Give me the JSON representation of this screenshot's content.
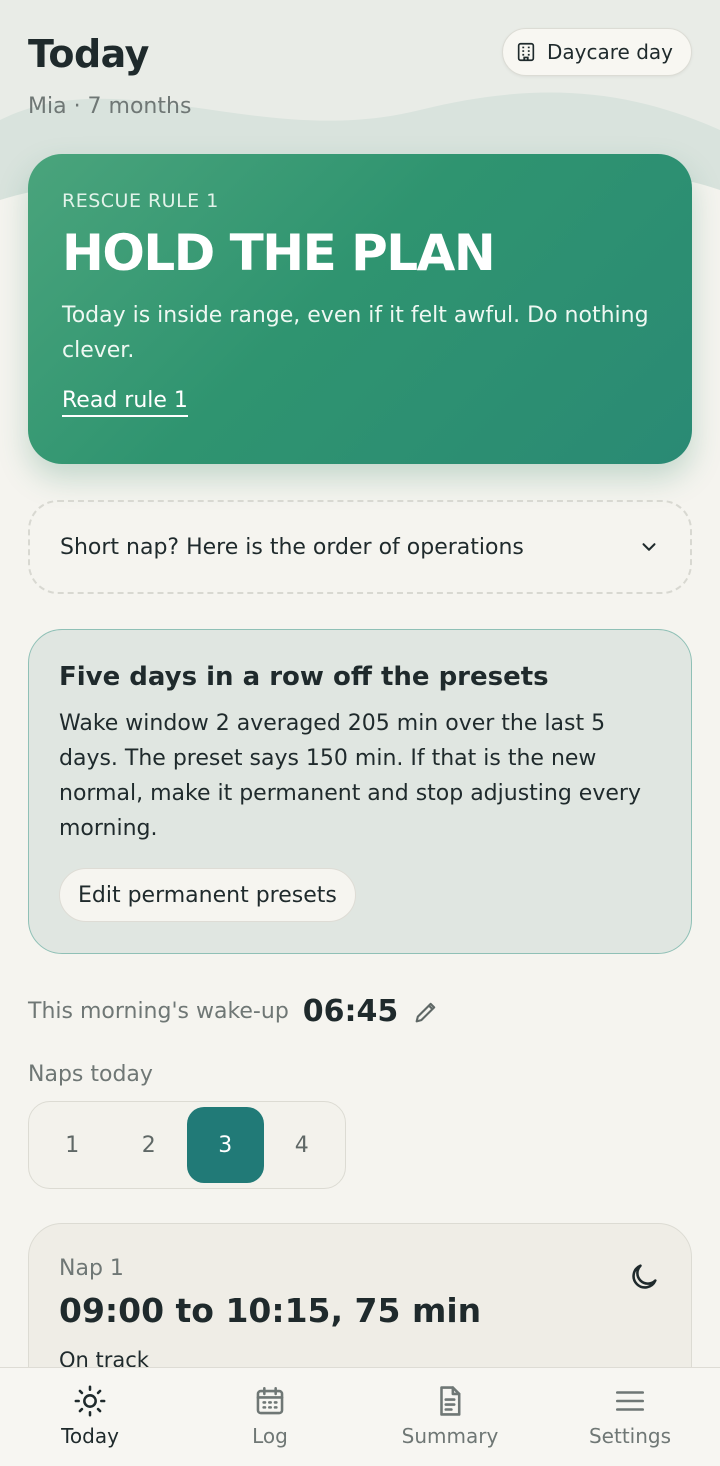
{
  "header": {
    "title": "Today",
    "subtitle": "Mia · 7 months",
    "daycare_button": {
      "label": "Daycare day",
      "icon": "building-icon"
    }
  },
  "rescue_card": {
    "kicker": "RESCUE RULE 1",
    "headline": "HOLD THE PLAN",
    "body": "Today is inside range, even if it felt awful. Do nothing clever.",
    "link": "Read rule 1",
    "colors": {
      "start": "#4aa47c",
      "end": "#2a8a74"
    }
  },
  "accordion": {
    "label": "Short nap? Here is the order of operations",
    "icon": "chevron-down-icon"
  },
  "preset_notice": {
    "title": "Five days in a row off the presets",
    "body": "Wake window 2 averaged 205 min over the last 5 days. The preset says 150 min. If that is the new normal, make it permanent and stop adjusting every morning.",
    "button": "Edit permanent presets"
  },
  "wake_up": {
    "label": "This morning's wake-up",
    "time": "06:45",
    "icon": "pencil-icon"
  },
  "naps": {
    "label": "Naps today",
    "options": [
      "1",
      "2",
      "3",
      "4"
    ],
    "selected": "3",
    "accent": "#217a77"
  },
  "nap_card": {
    "title": "Nap 1",
    "time": "09:00 to 10:15, 75 min",
    "status": "On track",
    "icon": "moon-icon"
  },
  "bottom_nav": {
    "items": [
      {
        "label": "Today",
        "icon": "sun-icon",
        "active": true
      },
      {
        "label": "Log",
        "icon": "calendar-icon",
        "active": false
      },
      {
        "label": "Summary",
        "icon": "document-icon",
        "active": false
      },
      {
        "label": "Settings",
        "icon": "menu-icon",
        "active": false
      }
    ]
  }
}
